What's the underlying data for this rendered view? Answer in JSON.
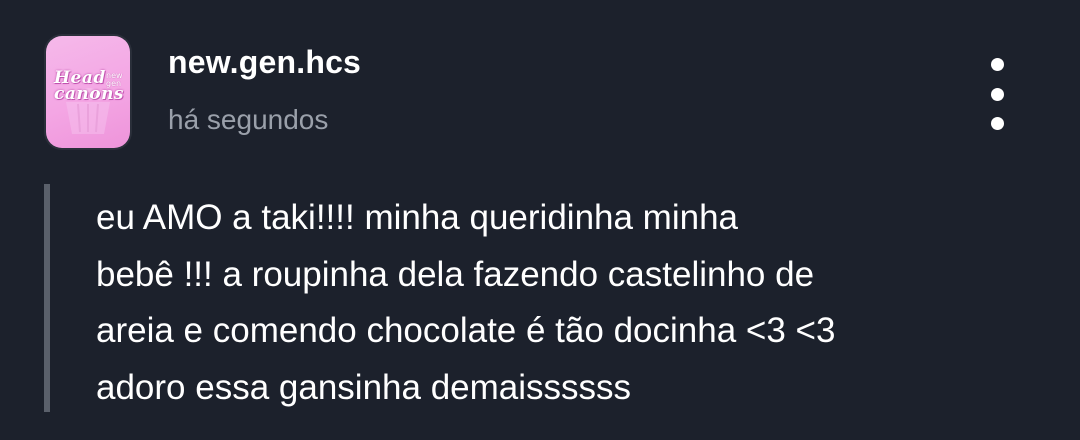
{
  "post": {
    "author": {
      "username": "new.gen.hcs",
      "avatar_logo_text": [
        "Head",
        "canons"
      ],
      "avatar_logo_small": [
        "new",
        "gen"
      ]
    },
    "timestamp": "há segundos",
    "body_lines": [
      "eu AMO a taki!!!! minha queridinha minha",
      "bebê !!! a roupinha dela fazendo castelinho de",
      "areia e comendo chocolate é tão docinha <3 <3",
      "adoro essa gansinha demaissssss"
    ]
  },
  "icons": {
    "menu": "more-vertical-icon"
  },
  "colors": {
    "background": "#1c212c",
    "text_primary": "#ffffff",
    "text_secondary": "#9aa0aa",
    "quote_bar": "#5a606b",
    "avatar_pink": "#f4a6e4"
  }
}
